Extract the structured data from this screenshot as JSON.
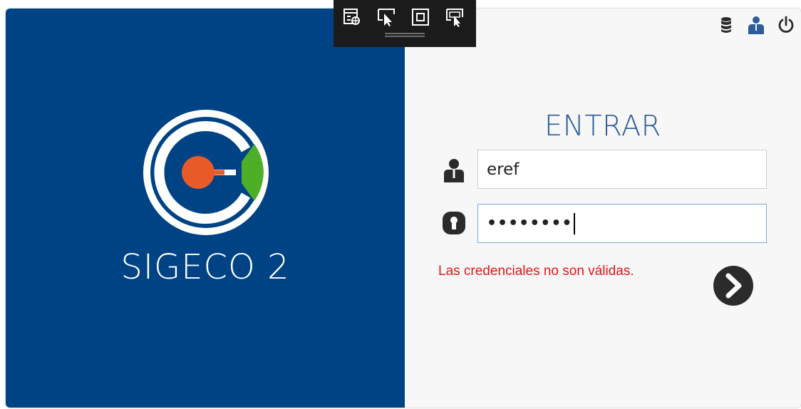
{
  "app": {
    "name": "SIGECO 2",
    "colors": {
      "brand_blue": "#004385",
      "logo_orange": "#e85a27",
      "logo_green": "#4caf27",
      "title_blue": "#2c5d98",
      "error_red": "#e8131b"
    }
  },
  "login": {
    "title": "ENTRAR",
    "username_value": "eref",
    "password_value": "••••••••",
    "error_message": "Las credenciales no son válidas.",
    "username_icon": "user-icon",
    "password_icon": "keyhole-icon",
    "submit_icon": "chevron-right-circle-icon"
  },
  "top_bar": {
    "icons": [
      "database-icon",
      "user-icon",
      "power-icon"
    ]
  },
  "dev_toolbar": {
    "icons": [
      "live-visual-tree-icon",
      "select-element-icon",
      "display-layout-adorners-icon",
      "track-focused-element-icon"
    ]
  }
}
